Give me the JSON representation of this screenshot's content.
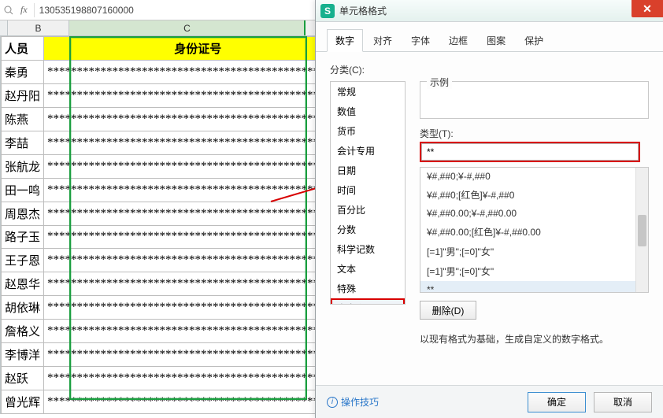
{
  "formula_bar": {
    "fx_label": "fx",
    "value": "130535198807160000"
  },
  "columns": {
    "B": "B",
    "C": "C"
  },
  "headers": {
    "name": "人员",
    "id": "身份证号"
  },
  "rows": [
    {
      "name": "秦勇",
      "id": "***************************************************"
    },
    {
      "name": "赵丹阳",
      "id": "***************************************************"
    },
    {
      "name": "陈燕",
      "id": "***************************************************"
    },
    {
      "name": "李喆",
      "id": "***************************************************"
    },
    {
      "name": "张航龙",
      "id": "***************************************************"
    },
    {
      "name": "田一鸣",
      "id": "***************************************************"
    },
    {
      "name": "周恩杰",
      "id": "***************************************************"
    },
    {
      "name": "路子玉",
      "id": "***************************************************"
    },
    {
      "name": "王子恩",
      "id": "***************************************************"
    },
    {
      "name": "赵恩华",
      "id": "***************************************************"
    },
    {
      "name": "胡依琳",
      "id": "***************************************************"
    },
    {
      "name": "詹格义",
      "id": "***************************************************"
    },
    {
      "name": "李博洋",
      "id": "***************************************************"
    },
    {
      "name": "赵跃",
      "id": "***************************************************"
    },
    {
      "name": "曾光辉",
      "id": "***************************************************"
    }
  ],
  "dialog": {
    "app_icon_letter": "S",
    "title": "单元格格式",
    "close_glyph": "✕",
    "tabs": [
      "数字",
      "对齐",
      "字体",
      "边框",
      "图案",
      "保护"
    ],
    "active_tab": 0,
    "category_label": "分类(C):",
    "categories": [
      "常规",
      "数值",
      "货币",
      "会计专用",
      "日期",
      "时间",
      "百分比",
      "分数",
      "科学记数",
      "文本",
      "特殊",
      "自定义"
    ],
    "selected_category_index": 11,
    "example_label": "示例",
    "type_label": "类型(T):",
    "type_value": "**",
    "format_list": [
      "¥#,##0;¥-#,##0",
      "¥#,##0;[红色]¥-#,##0",
      "¥#,##0.00;¥-#,##0.00",
      "¥#,##0.00;[红色]¥-#,##0.00",
      "[=1]\"男\";[=0]\"女\"",
      "[=1]\"男\";[=0]\"女\"",
      "**"
    ],
    "selected_format_index": 6,
    "delete_label": "删除(D)",
    "hint": "以现有格式为基础，生成自定义的数字格式。",
    "tips_label": "操作技巧",
    "ok_label": "确定",
    "cancel_label": "取消"
  }
}
